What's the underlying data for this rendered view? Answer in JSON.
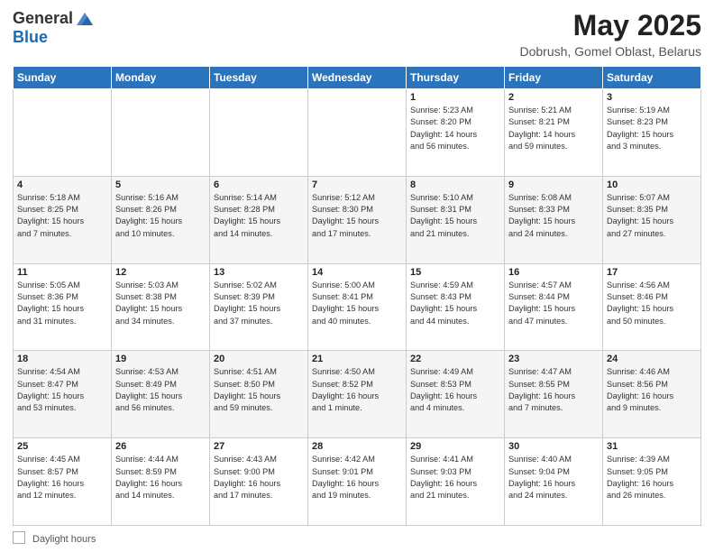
{
  "header": {
    "logo_general": "General",
    "logo_blue": "Blue",
    "title": "May 2025",
    "subtitle": "Dobrush, Gomel Oblast, Belarus"
  },
  "days_of_week": [
    "Sunday",
    "Monday",
    "Tuesday",
    "Wednesday",
    "Thursday",
    "Friday",
    "Saturday"
  ],
  "footer": {
    "daylight_label": "Daylight hours"
  },
  "weeks": [
    [
      {
        "day": "",
        "info": ""
      },
      {
        "day": "",
        "info": ""
      },
      {
        "day": "",
        "info": ""
      },
      {
        "day": "",
        "info": ""
      },
      {
        "day": "1",
        "info": "Sunrise: 5:23 AM\nSunset: 8:20 PM\nDaylight: 14 hours\nand 56 minutes."
      },
      {
        "day": "2",
        "info": "Sunrise: 5:21 AM\nSunset: 8:21 PM\nDaylight: 14 hours\nand 59 minutes."
      },
      {
        "day": "3",
        "info": "Sunrise: 5:19 AM\nSunset: 8:23 PM\nDaylight: 15 hours\nand 3 minutes."
      }
    ],
    [
      {
        "day": "4",
        "info": "Sunrise: 5:18 AM\nSunset: 8:25 PM\nDaylight: 15 hours\nand 7 minutes."
      },
      {
        "day": "5",
        "info": "Sunrise: 5:16 AM\nSunset: 8:26 PM\nDaylight: 15 hours\nand 10 minutes."
      },
      {
        "day": "6",
        "info": "Sunrise: 5:14 AM\nSunset: 8:28 PM\nDaylight: 15 hours\nand 14 minutes."
      },
      {
        "day": "7",
        "info": "Sunrise: 5:12 AM\nSunset: 8:30 PM\nDaylight: 15 hours\nand 17 minutes."
      },
      {
        "day": "8",
        "info": "Sunrise: 5:10 AM\nSunset: 8:31 PM\nDaylight: 15 hours\nand 21 minutes."
      },
      {
        "day": "9",
        "info": "Sunrise: 5:08 AM\nSunset: 8:33 PM\nDaylight: 15 hours\nand 24 minutes."
      },
      {
        "day": "10",
        "info": "Sunrise: 5:07 AM\nSunset: 8:35 PM\nDaylight: 15 hours\nand 27 minutes."
      }
    ],
    [
      {
        "day": "11",
        "info": "Sunrise: 5:05 AM\nSunset: 8:36 PM\nDaylight: 15 hours\nand 31 minutes."
      },
      {
        "day": "12",
        "info": "Sunrise: 5:03 AM\nSunset: 8:38 PM\nDaylight: 15 hours\nand 34 minutes."
      },
      {
        "day": "13",
        "info": "Sunrise: 5:02 AM\nSunset: 8:39 PM\nDaylight: 15 hours\nand 37 minutes."
      },
      {
        "day": "14",
        "info": "Sunrise: 5:00 AM\nSunset: 8:41 PM\nDaylight: 15 hours\nand 40 minutes."
      },
      {
        "day": "15",
        "info": "Sunrise: 4:59 AM\nSunset: 8:43 PM\nDaylight: 15 hours\nand 44 minutes."
      },
      {
        "day": "16",
        "info": "Sunrise: 4:57 AM\nSunset: 8:44 PM\nDaylight: 15 hours\nand 47 minutes."
      },
      {
        "day": "17",
        "info": "Sunrise: 4:56 AM\nSunset: 8:46 PM\nDaylight: 15 hours\nand 50 minutes."
      }
    ],
    [
      {
        "day": "18",
        "info": "Sunrise: 4:54 AM\nSunset: 8:47 PM\nDaylight: 15 hours\nand 53 minutes."
      },
      {
        "day": "19",
        "info": "Sunrise: 4:53 AM\nSunset: 8:49 PM\nDaylight: 15 hours\nand 56 minutes."
      },
      {
        "day": "20",
        "info": "Sunrise: 4:51 AM\nSunset: 8:50 PM\nDaylight: 15 hours\nand 59 minutes."
      },
      {
        "day": "21",
        "info": "Sunrise: 4:50 AM\nSunset: 8:52 PM\nDaylight: 16 hours\nand 1 minute."
      },
      {
        "day": "22",
        "info": "Sunrise: 4:49 AM\nSunset: 8:53 PM\nDaylight: 16 hours\nand 4 minutes."
      },
      {
        "day": "23",
        "info": "Sunrise: 4:47 AM\nSunset: 8:55 PM\nDaylight: 16 hours\nand 7 minutes."
      },
      {
        "day": "24",
        "info": "Sunrise: 4:46 AM\nSunset: 8:56 PM\nDaylight: 16 hours\nand 9 minutes."
      }
    ],
    [
      {
        "day": "25",
        "info": "Sunrise: 4:45 AM\nSunset: 8:57 PM\nDaylight: 16 hours\nand 12 minutes."
      },
      {
        "day": "26",
        "info": "Sunrise: 4:44 AM\nSunset: 8:59 PM\nDaylight: 16 hours\nand 14 minutes."
      },
      {
        "day": "27",
        "info": "Sunrise: 4:43 AM\nSunset: 9:00 PM\nDaylight: 16 hours\nand 17 minutes."
      },
      {
        "day": "28",
        "info": "Sunrise: 4:42 AM\nSunset: 9:01 PM\nDaylight: 16 hours\nand 19 minutes."
      },
      {
        "day": "29",
        "info": "Sunrise: 4:41 AM\nSunset: 9:03 PM\nDaylight: 16 hours\nand 21 minutes."
      },
      {
        "day": "30",
        "info": "Sunrise: 4:40 AM\nSunset: 9:04 PM\nDaylight: 16 hours\nand 24 minutes."
      },
      {
        "day": "31",
        "info": "Sunrise: 4:39 AM\nSunset: 9:05 PM\nDaylight: 16 hours\nand 26 minutes."
      }
    ]
  ]
}
